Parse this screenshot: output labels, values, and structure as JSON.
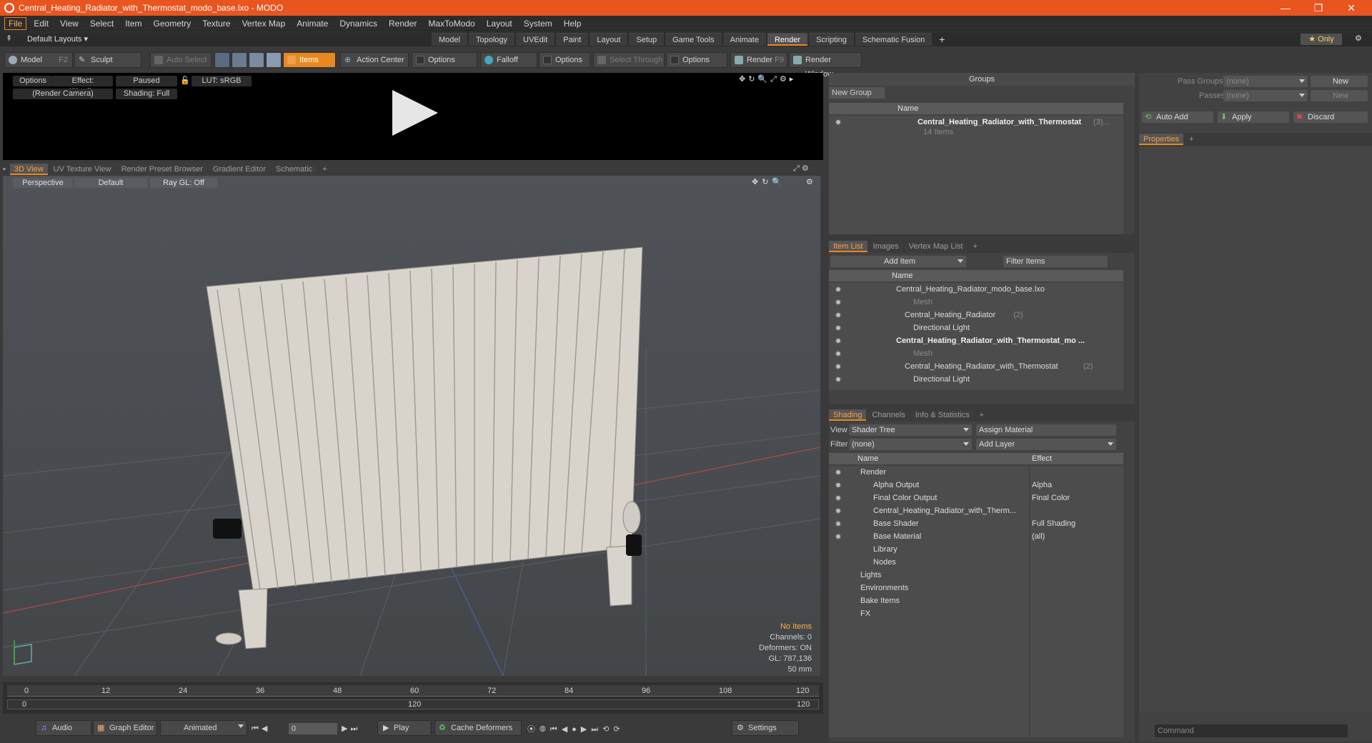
{
  "window": {
    "title": "Central_Heating_Radiator_with_Thermostat_modo_base.lxo - MODO",
    "controls": [
      "—",
      "❐",
      "✕"
    ]
  },
  "menu": [
    "File",
    "Edit",
    "View",
    "Select",
    "Item",
    "Geometry",
    "Texture",
    "Vertex Map",
    "Animate",
    "Dynamics",
    "Render",
    "MaxToModo",
    "Layout",
    "System",
    "Help"
  ],
  "layouts": {
    "default_label": "Default Layouts ▾",
    "tabs": [
      "Model",
      "Topology",
      "UVEdit",
      "Paint",
      "Layout",
      "Setup",
      "Game Tools",
      "Animate",
      "Render",
      "Scripting",
      "Schematic Fusion"
    ],
    "active": "Render",
    "plus": "+",
    "only_label": "★ Only"
  },
  "toolbar": {
    "model": "Model",
    "model_key": "F2",
    "sculpt": "Sculpt",
    "auto_select": "Auto Select",
    "items": "Items",
    "action_center": "Action Center",
    "options1": "Options",
    "falloff": "Falloff",
    "options2": "Options",
    "select_through": "Select Through",
    "options3": "Options",
    "render": "Render",
    "render_key": "F9",
    "render_window": "Render Window"
  },
  "render_pane": {
    "options": "Options",
    "effect": "Effect: (Shadi...",
    "paused": "Paused",
    "lut": "LUT: sRGB",
    "camera": "(Render Camera)",
    "shading": "Shading: Full"
  },
  "viewport_tabs": [
    "3D View",
    "UV Texture View",
    "Render Preset Browser",
    "Gradient Editor",
    "Schematic",
    "+"
  ],
  "viewport": {
    "perspective": "Perspective",
    "default": "Default",
    "raygl": "Ray GL: Off",
    "status": {
      "no_items": "No Items",
      "channels": "Channels: 0",
      "deformers": "Deformers: ON",
      "gl": "GL: 787,136",
      "mm": "50 mm"
    }
  },
  "timeline": {
    "ticks": [
      "0",
      "12",
      "24",
      "36",
      "48",
      "60",
      "72",
      "84",
      "96",
      "108",
      "120"
    ],
    "left_end": "0",
    "mid": "120",
    "right_end": "120"
  },
  "bottom": {
    "audio": "Audio",
    "graph_editor": "Graph Editor",
    "animated": "Animated",
    "frame": "0",
    "play": "Play",
    "cache_deformers": "Cache Deformers",
    "settings": "Settings"
  },
  "groups": {
    "title": "Groups",
    "new_group": "New Group",
    "col_name": "Name",
    "item_name": "Central_Heating_Radiator_with_Thermostat",
    "item_count": "(3)...",
    "item_sub": "14 Items"
  },
  "item_list": {
    "tabs": [
      "Item List",
      "Images",
      "Vertex Map List",
      "+"
    ],
    "add_item": "Add Item",
    "filter": "Filter Items",
    "col_name": "Name",
    "rows": [
      {
        "label": "Central_Heating_Radiator_modo_base.lxo",
        "indent": 0,
        "bold": false,
        "dim": false,
        "count": ""
      },
      {
        "label": "Mesh",
        "indent": 2,
        "bold": false,
        "dim": true,
        "count": ""
      },
      {
        "label": "Central_Heating_Radiator",
        "indent": 1,
        "bold": false,
        "dim": false,
        "count": "(2)"
      },
      {
        "label": "Directional Light",
        "indent": 2,
        "bold": false,
        "dim": false,
        "count": ""
      },
      {
        "label": "Central_Heating_Radiator_with_Thermostat_mo ...",
        "indent": 0,
        "bold": true,
        "dim": false,
        "count": ""
      },
      {
        "label": "Mesh",
        "indent": 2,
        "bold": false,
        "dim": true,
        "count": ""
      },
      {
        "label": "Central_Heating_Radiator_with_Thermostat",
        "indent": 1,
        "bold": false,
        "dim": false,
        "count": "(2)"
      },
      {
        "label": "Directional Light",
        "indent": 2,
        "bold": false,
        "dim": false,
        "count": ""
      }
    ]
  },
  "shading": {
    "tabs": [
      "Shading",
      "Channels",
      "Info & Statistics",
      "+"
    ],
    "view_label": "View",
    "view_value": "Shader Tree",
    "assign_material": "Assign Material",
    "filter_label": "Filter",
    "filter_value": "(none)",
    "add_layer": "Add Layer",
    "col_name": "Name",
    "col_effect": "Effect",
    "rows": [
      {
        "label": "Render",
        "effect": "",
        "indent": 0
      },
      {
        "label": "Alpha Output",
        "effect": "Alpha",
        "indent": 1
      },
      {
        "label": "Final Color Output",
        "effect": "Final Color",
        "indent": 1
      },
      {
        "label": "Central_Heating_Radiator_with_Therm...",
        "effect": "",
        "indent": 1
      },
      {
        "label": "Base Shader",
        "effect": "Full Shading",
        "indent": 1
      },
      {
        "label": "Base Material",
        "effect": "(all)",
        "indent": 1
      },
      {
        "label": "Library",
        "effect": "",
        "indent": 1
      },
      {
        "label": "Nodes",
        "effect": "",
        "indent": 1
      },
      {
        "label": "Lights",
        "effect": "",
        "indent": 0
      },
      {
        "label": "Environments",
        "effect": "",
        "indent": 0
      },
      {
        "label": "Bake Items",
        "effect": "",
        "indent": 0
      },
      {
        "label": "FX",
        "effect": "",
        "indent": 0
      }
    ]
  },
  "properties": {
    "pass_groups": "Pass Groups",
    "pass_groups_val": "(none)",
    "passes": "Passes",
    "passes_val": "(none)",
    "new": "New",
    "new2": "New",
    "auto_add": "Auto Add",
    "apply": "Apply",
    "discard": "Discard",
    "tab": "Properties",
    "plus": "+",
    "command": "Command"
  },
  "colors": {
    "accent": "#e8891f",
    "titlebar": "#e8551f"
  }
}
